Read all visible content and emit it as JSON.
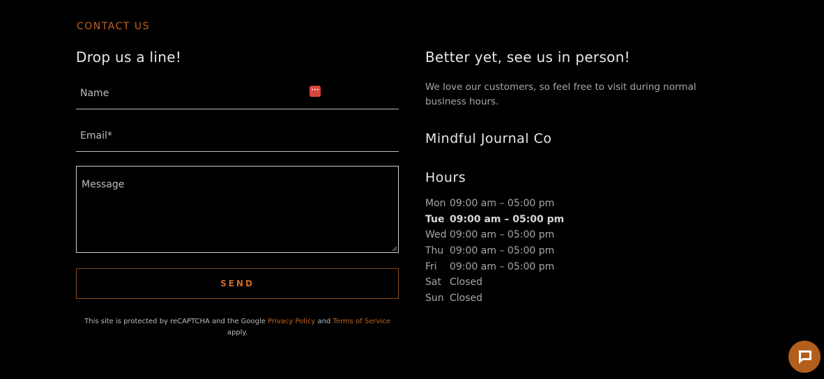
{
  "section_label": "CONTACT US",
  "form": {
    "heading": "Drop us a line!",
    "name_placeholder": "Name",
    "email_placeholder": "Email*",
    "message_placeholder": "Message",
    "send_label": "SEND",
    "recaptcha": {
      "prefix": "This site is protected by reCAPTCHA and the Google ",
      "privacy_link": "Privacy Policy",
      "middle": " and ",
      "terms_link": "Terms of Service",
      "suffix": " apply."
    }
  },
  "visit": {
    "heading": "Better yet, see us in person!",
    "intro": "We love our customers, so feel free to visit during normal business hours.",
    "company": "Mindful Journal Co",
    "hours_title": "Hours",
    "hours": [
      {
        "day": "Mon",
        "time": "09:00 am – 05:00 pm",
        "today": false
      },
      {
        "day": "Tue",
        "time": "09:00 am – 05:00 pm",
        "today": true
      },
      {
        "day": "Wed",
        "time": "09:00 am – 05:00 pm",
        "today": false
      },
      {
        "day": "Thu",
        "time": "09:00 am – 05:00 pm",
        "today": false
      },
      {
        "day": "Fri",
        "time": "09:00 am – 05:00 pm",
        "today": false
      },
      {
        "day": "Sat",
        "time": "Closed",
        "today": false
      },
      {
        "day": "Sun",
        "time": "Closed",
        "today": false
      }
    ]
  },
  "colors": {
    "accent": "#c4621f",
    "background": "#000000",
    "chat_button": "#b35f1c"
  },
  "icons": {
    "password_manager": "password-manager-icon",
    "chat": "chat-bubble-icon"
  }
}
